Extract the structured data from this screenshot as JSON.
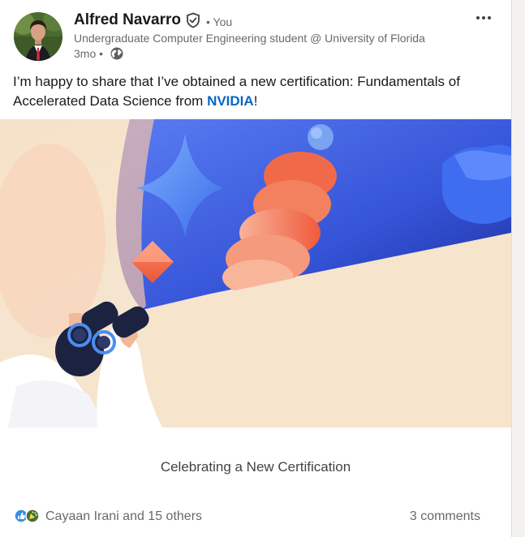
{
  "post": {
    "author_name": "Alfred Navarro",
    "author_relation": "• You",
    "author_headline": "Undergraduate Computer Engineering student @ University of Florida",
    "time_ago": "3mo •",
    "text_before_mention": "I’m happy to share that I’ve obtained a new certification: Fundamentals of Accelerated Data Science from ",
    "mention": "NVIDIA",
    "text_after_mention": "!",
    "image_caption": "Celebrating a New Certification",
    "reactions_summary": "Cayaan Irani and 15 others",
    "comments_count": "3 comments"
  },
  "icons": {
    "verified": "verified-shield-icon",
    "visibility": "globe-icon",
    "more": "more-options-icon",
    "reactions": [
      "like-reaction-icon",
      "celebrate-reaction-icon"
    ]
  },
  "colors": {
    "mention": "#0a66c2",
    "like": "#378fe9",
    "celebrate": "#44712e",
    "hero_blue": "#3d5ee0",
    "hero_coral": "#f26c4f",
    "hero_cream": "#f6e3cb"
  }
}
